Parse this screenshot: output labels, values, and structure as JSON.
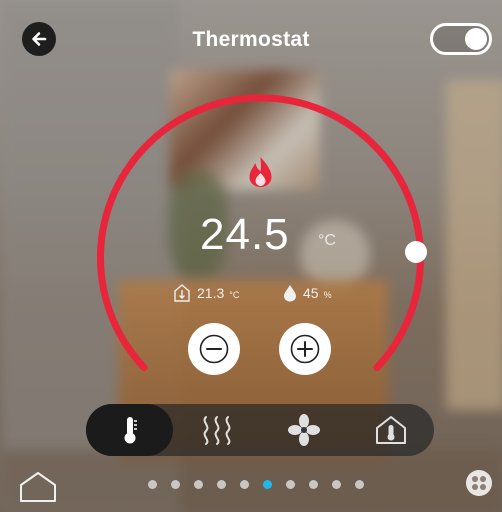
{
  "header": {
    "title": "Thermostat"
  },
  "toggle": {
    "on": true
  },
  "dial": {
    "setpoint": "24.5",
    "unit": "°C",
    "accent_color": "#e8253a",
    "flame_icon": "flame-icon"
  },
  "readings": {
    "indoor_temp": "21.3",
    "indoor_temp_unit": "°C",
    "humidity": "45",
    "humidity_unit": "%"
  },
  "modes": [
    {
      "name": "thermometer-icon",
      "active": true
    },
    {
      "name": "heat-waves-icon",
      "active": false
    },
    {
      "name": "fan-icon",
      "active": false
    },
    {
      "name": "home-thermostat-icon",
      "active": false
    }
  ],
  "pager": {
    "count": 10,
    "active_index": 5,
    "active_color": "#1fb8ea"
  }
}
